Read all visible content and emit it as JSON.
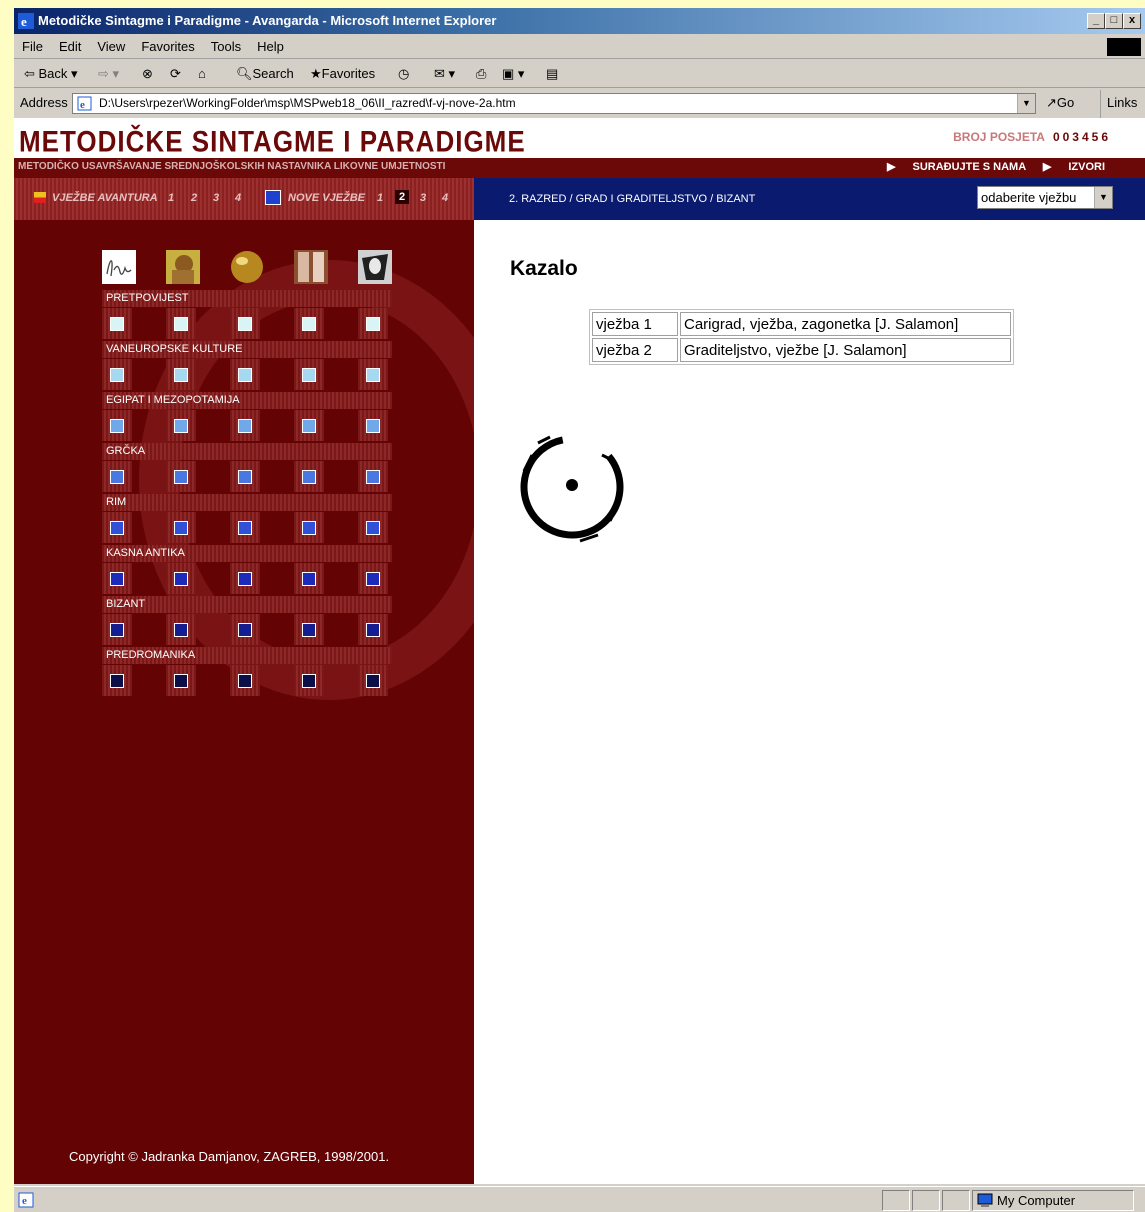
{
  "window": {
    "title": "Metodičke Sintagme i Paradigme - Avangarda - Microsoft Internet Explorer",
    "controls": [
      "_",
      "□",
      "x"
    ]
  },
  "menu": [
    "File",
    "Edit",
    "View",
    "Favorites",
    "Tools",
    "Help"
  ],
  "toolbar": {
    "back": "Back",
    "search": "Search",
    "favorites": "Favorites"
  },
  "address": {
    "label": "Address",
    "url": "D:\\Users\\rpezer\\WorkingFolder\\msp\\MSPweb18_06\\II_razred\\f-vj-nove-2a.htm",
    "go": "Go",
    "links": "Links »"
  },
  "site": {
    "logo": "METODIČKE SINTAGME I PARADIGME",
    "subtitle": "METODIČKO USAVRŠAVANJE SREDNJOŠKOLSKIH NASTAVNIKA LIKOVNE UMJETNOSTI",
    "visits_label": "BROJ POSJETA",
    "visits_count": "003456",
    "links": [
      "SURAĐUJTE S NAMA",
      "IZVORI"
    ]
  },
  "nav": {
    "avantura_label": "VJEŽBE AVANTURA",
    "avantura_nums": [
      "1",
      "2",
      "3",
      "4"
    ],
    "nove_label": "NOVE VJEŽBE",
    "nove_nums": [
      "1",
      "2",
      "3",
      "4"
    ],
    "active_nove": "2",
    "breadcrumb": "2. RAZRED / GRAD I GRADITELJSTVO / BIZANT",
    "select_value": "odaberite vježbu"
  },
  "sidebar": {
    "icons": [
      "signature-icon",
      "fresco-icon",
      "sphere-icon",
      "doorway-icon",
      "face-icon"
    ],
    "rows": [
      {
        "label": "PRETPOVIJEST",
        "color": "#d8f4f4"
      },
      {
        "label": "VANEUROPSKE KULTURE",
        "color": "#a8d8f0"
      },
      {
        "label": "EGIPAT I MEZOPOTAMIJA",
        "color": "#70a8ec"
      },
      {
        "label": "GRČKA",
        "color": "#4878e0"
      },
      {
        "label": "RIM",
        "color": "#3050d8"
      },
      {
        "label": "KASNA ANTIKA",
        "color": "#1c2cb8"
      },
      {
        "label": "BIZANT",
        "color": "#141e90"
      },
      {
        "label": "PREDROMANIKA",
        "color": "#0c1048"
      }
    ],
    "copyright": "Copyright © Jadranka Damjanov, ZAGREB, 1998/2001."
  },
  "content": {
    "heading": "Kazalo",
    "rows": [
      {
        "num": "vježba 1",
        "title": "Carigrad, vježba, zagonetka [J. Salamon]"
      },
      {
        "num": "vježba 2",
        "title": "Graditeljstvo, vježbe [J. Salamon]"
      }
    ]
  },
  "status": {
    "zone": "My Computer"
  }
}
